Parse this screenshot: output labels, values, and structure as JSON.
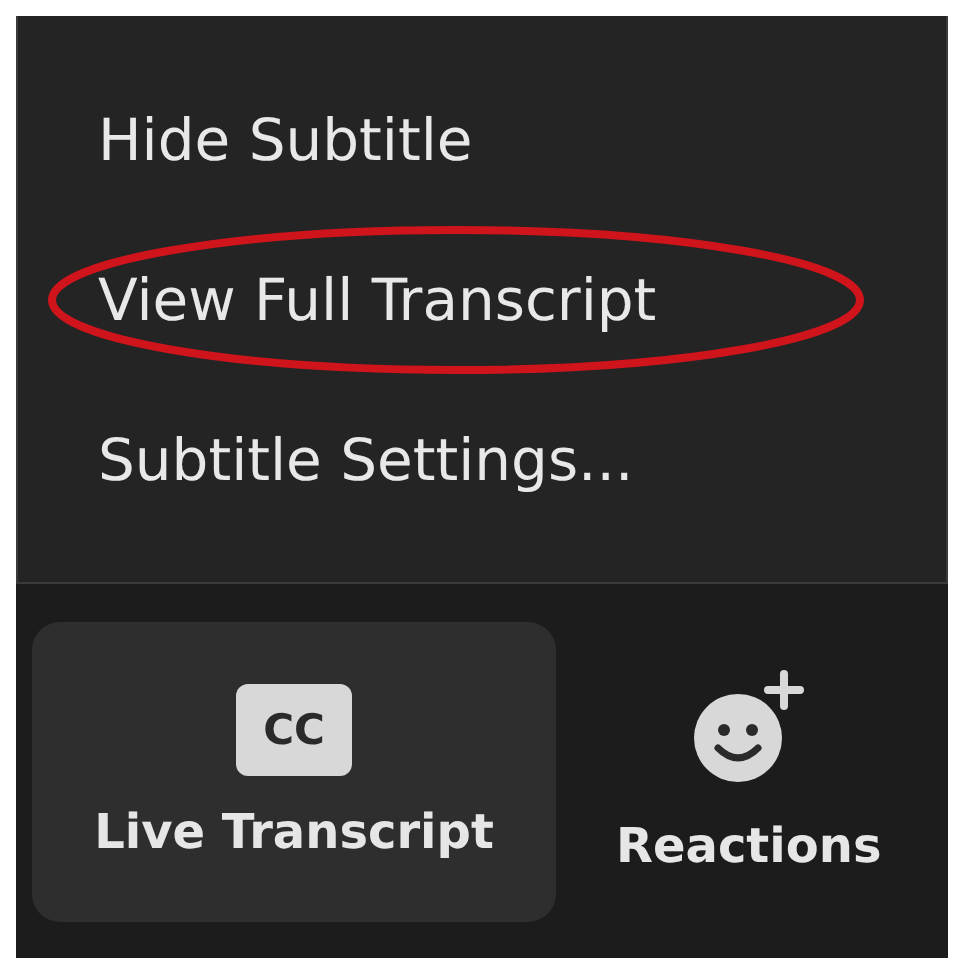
{
  "menu": {
    "items": [
      {
        "label": "Hide Subtitle",
        "highlighted": false
      },
      {
        "label": "View Full Transcript",
        "highlighted": true
      },
      {
        "label": "Subtitle Settings...",
        "highlighted": false
      }
    ]
  },
  "toolbar": {
    "buttons": [
      {
        "kind": "cc",
        "icon_text": "CC",
        "label": "Live Transcript",
        "selected": true
      },
      {
        "kind": "reactions",
        "label": "Reactions",
        "selected": false
      }
    ]
  }
}
